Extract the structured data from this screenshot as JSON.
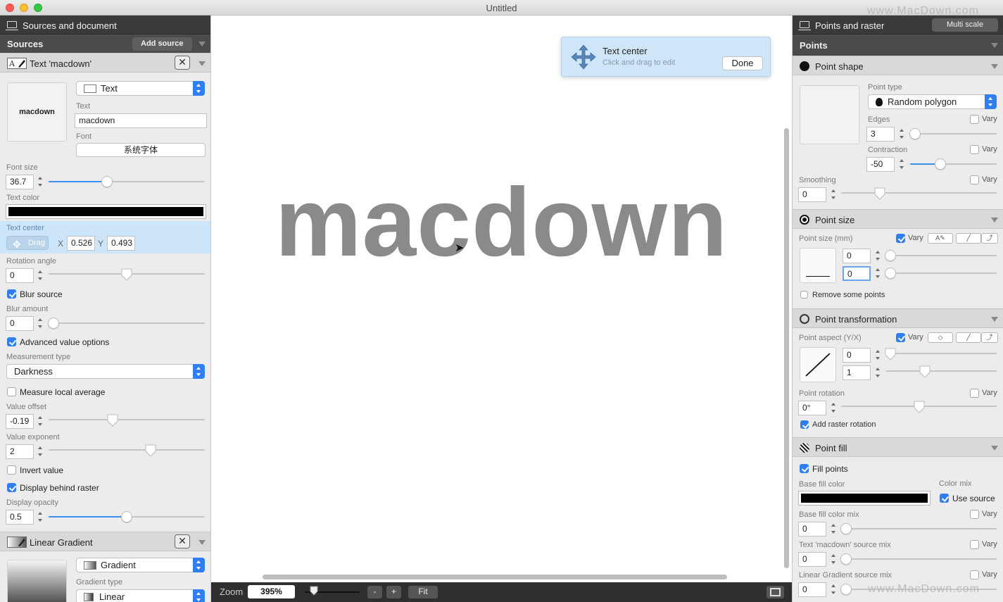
{
  "window": {
    "title": "Untitled",
    "watermark": "www.MacDown.com"
  },
  "left": {
    "header": "Sources and document",
    "sources_label": "Sources",
    "add_source": "Add source",
    "source1": {
      "title": "Text 'macdown'",
      "thumb_text": "macdown",
      "type": "Text",
      "text_label": "Text",
      "text_value": "macdown",
      "font_label": "Font",
      "font_button": "系统字体",
      "font_size_label": "Font size",
      "font_size": "36.7",
      "text_color_label": "Text color",
      "text_center_label": "Text center",
      "drag": "Drag",
      "x_label": "X",
      "x_value": "0.526",
      "y_label": "Y",
      "y_value": "0.493",
      "rotation_label": "Rotation angle",
      "rotation": "0",
      "blur_source": "Blur source",
      "blur_amount_label": "Blur amount",
      "blur_amount": "0",
      "advanced": "Advanced value options",
      "measurement_label": "Measurement type",
      "measurement": "Darkness",
      "measure_local": "Measure local average",
      "offset_label": "Value offset",
      "offset": "-0.19",
      "exponent_label": "Value exponent",
      "exponent": "2",
      "invert": "Invert value",
      "display_behind": "Display behind raster",
      "opacity_label": "Display opacity",
      "opacity": "0.5"
    },
    "source2": {
      "title": "Linear Gradient",
      "type": "Gradient",
      "gradient_type_label": "Gradient type",
      "gradient_type": "Linear"
    }
  },
  "canvas": {
    "big_text": "macdown",
    "popover_title": "Text center",
    "popover_sub": "Click and drag to edit",
    "done": "Done"
  },
  "bottom": {
    "zoom_label": "Zoom",
    "zoom": "395%",
    "minus": "-",
    "plus": "+",
    "fit": "Fit"
  },
  "right": {
    "header": "Points and raster",
    "multi_scale": "Multi scale",
    "points_label": "Points",
    "shape": {
      "title": "Point shape",
      "point_type_label": "Point type",
      "point_type": "Random polygon",
      "edges_label": "Edges",
      "edges": "3",
      "contraction_label": "Contraction",
      "contraction": "-50",
      "smoothing_label": "Smoothing",
      "smoothing": "0",
      "vary": "Vary"
    },
    "size": {
      "title": "Point size",
      "size_label": "Point size (mm)",
      "v1": "0",
      "v2": "0",
      "remove": "Remove some points",
      "vary": "Vary"
    },
    "transform": {
      "title": "Point transformation",
      "aspect_label": "Point aspect (Y/X)",
      "a1": "0",
      "a2": "1",
      "rotation_label": "Point rotation",
      "rotation": "0°",
      "add_raster": "Add raster rotation",
      "vary": "Vary"
    },
    "fill": {
      "title": "Point fill",
      "fill_points": "Fill points",
      "base_color_label": "Base fill color",
      "color_mix_label": "Color mix",
      "use_source": "Use source",
      "base_mix_label": "Base fill color mix",
      "base_mix": "0",
      "text_mix_label": "Text 'macdown' source mix",
      "text_mix": "0",
      "gradient_mix_label": "Linear Gradient source mix",
      "gradient_mix": "0",
      "vary": "Vary"
    }
  },
  "colors": {
    "accent": "#2f7ef2",
    "highlight": "#cde5f8",
    "dark_header": "#3a3a3a"
  }
}
